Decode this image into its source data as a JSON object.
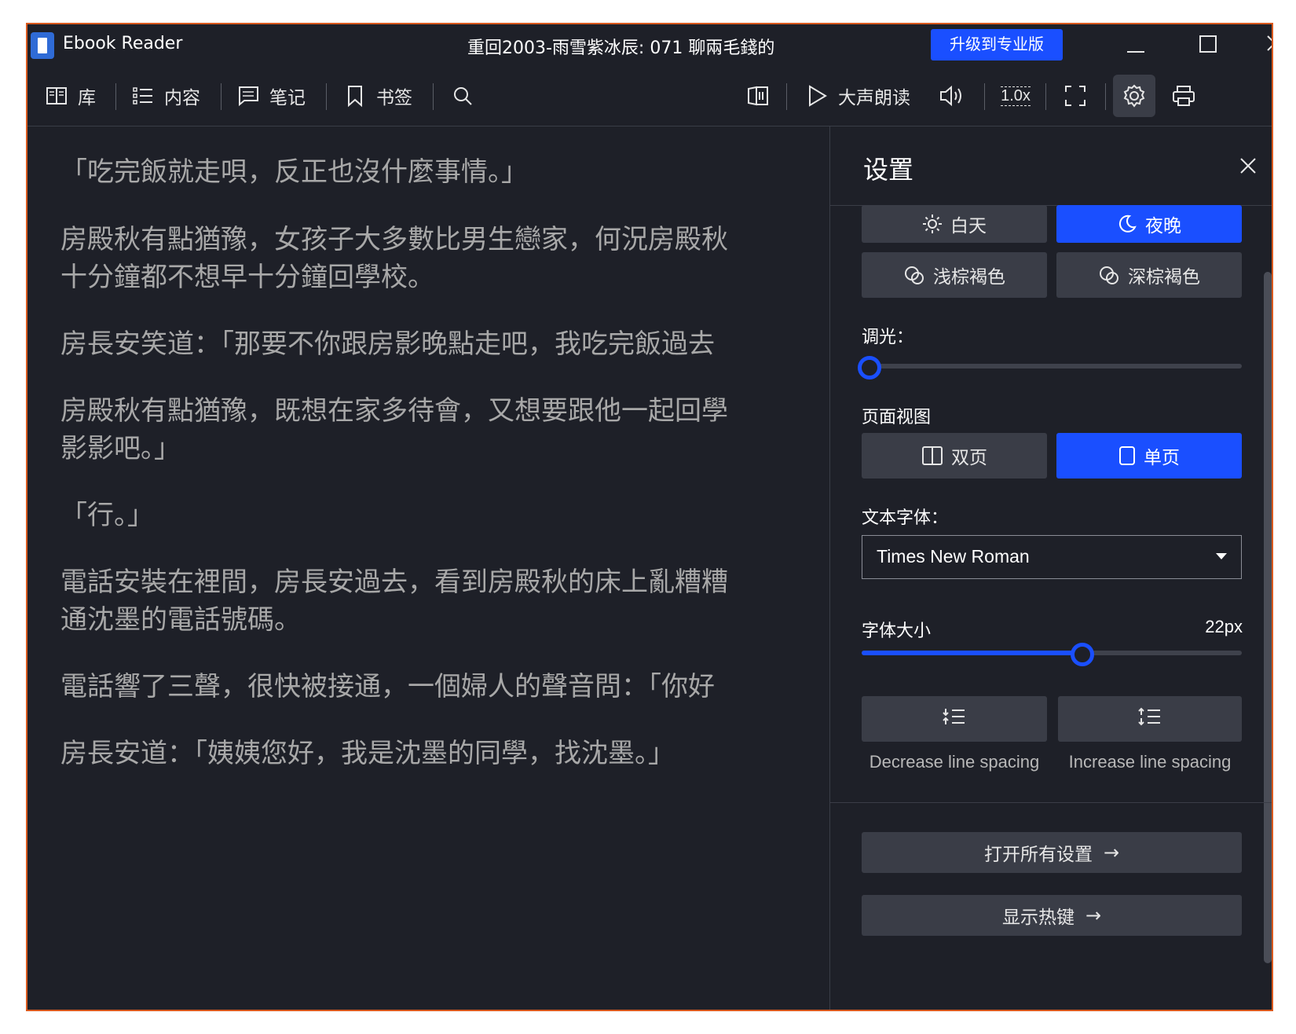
{
  "window": {
    "app_name": "Ebook Reader",
    "doc_title": "重回2003-雨雪紫冰辰: 071 聊兩毛錢的",
    "upgrade_label": "升级到专业版"
  },
  "toolbar": {
    "library": "库",
    "contents": "内容",
    "notes": "笔记",
    "bookmarks": "书签",
    "read_aloud": "大声朗读",
    "speed": "1.0x"
  },
  "reader": {
    "paragraphs": [
      "「吃完飯就走唄，反正也沒什麼事情。」",
      "房殿秋有點猶豫，女孩子大多數比男生戀家，何況房殿秋",
      "十分鐘都不想早十分鐘回學校。",
      "房長安笑道：「那要不你跟房影晚點走吧，我吃完飯過去",
      "房殿秋有點猶豫，既想在家多待會，又想要跟他一起回學",
      "影影吧。」",
      "「行。」",
      "電話安裝在裡間，房長安過去，看到房殿秋的床上亂糟糟",
      "通沈墨的電話號碼。",
      "電話響了三聲，很快被接通，一個婦人的聲音問：「你好",
      "房長安道：「姨姨您好，我是沈墨的同學，找沈墨。」"
    ]
  },
  "settings": {
    "title": "设置",
    "themes": {
      "day": "白天",
      "night": "夜晚",
      "light_sepia": "浅棕褐色",
      "dark_sepia": "深棕褐色"
    },
    "dimming_label": "调光：",
    "dimming_value": 0,
    "page_view_label": "页面视图",
    "page_view": {
      "double": "双页",
      "single": "单页"
    },
    "font_label": "文本字体：",
    "font_value": "Times New Roman",
    "font_size_label": "字体大小",
    "font_size_value": "22px",
    "font_size_fraction": 0.58,
    "decrease_spacing": "Decrease line spacing",
    "increase_spacing": "Increase line spacing",
    "open_all_settings": "打开所有设置",
    "show_hotkeys": "显示热键"
  },
  "colors": {
    "accent": "#1a4fff",
    "frame": "#d9591e",
    "background": "#1e2028"
  }
}
